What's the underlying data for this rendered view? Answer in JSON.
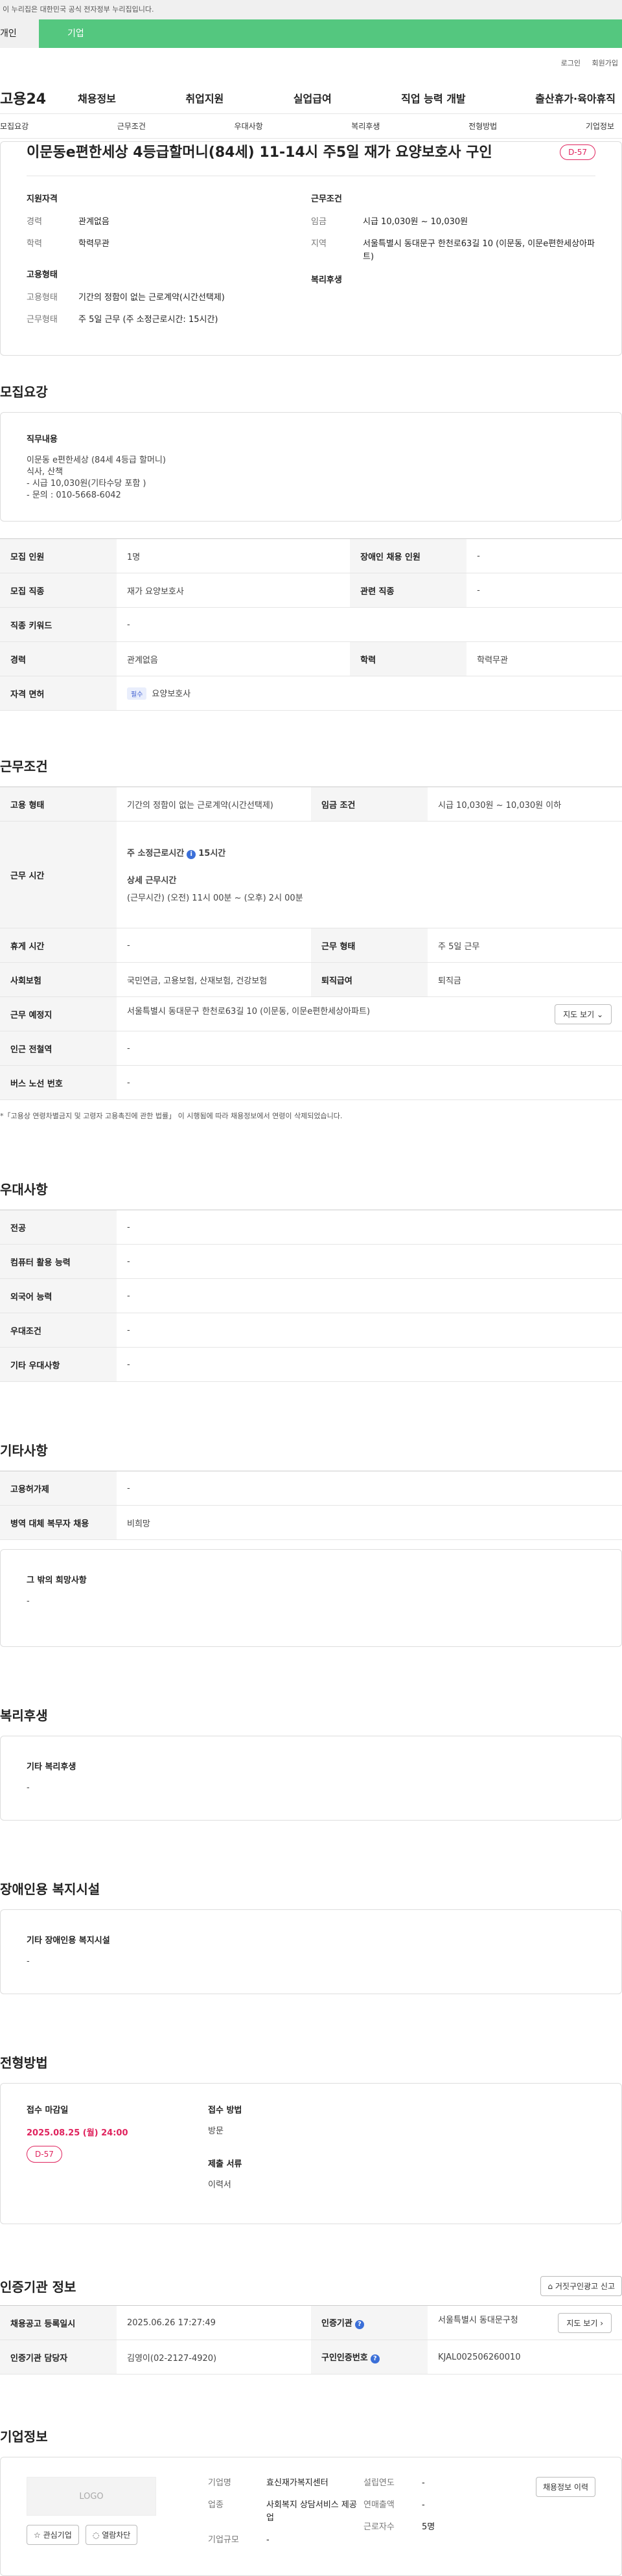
{
  "gov_bar": "이 누리집은 대한민국 공식 전자정부 누리집입니다.",
  "tabs": {
    "individual": "개인",
    "company": "기업"
  },
  "util": {
    "login": "로그인",
    "signup": "회원가입"
  },
  "gnb": {
    "logo": "고용24",
    "menu": [
      "채용정보",
      "취업지원",
      "실업급여",
      "직업 능력 개발",
      "출산휴가·육아휴직"
    ]
  },
  "subnav": [
    "모집요강",
    "근무조건",
    "우대사항",
    "복리후생",
    "전형방법",
    "기업정보"
  ],
  "summary": {
    "title": "이문동e편한세상 4등급할머니(84세) 11-14시 주5일 재가 요양보호사 구인",
    "dday": "D-57",
    "qual_h": "지원자격",
    "career_k": "경력",
    "career_v": "관계없음",
    "edu_k": "학력",
    "edu_v": "학력무관",
    "emp_h": "고용형태",
    "emp_k": "고용형태",
    "emp_v": "기간의 정함이 없는 근로계약(시간선택제)",
    "work_k": "근무형태",
    "work_v": "주 5일 근무 (주 소정근로시간: 15시간)",
    "cond_h": "근무조건",
    "wage_k": "임금",
    "wage_v": "시급 10,030원 ~ 10,030원",
    "region_k": "지역",
    "region_v": "서울특별시 동대문구 한천로63길 10 (이문동, 이문e편한세상아파트)",
    "welfare_h": "복리후생"
  },
  "recruit": {
    "title": "모집요강",
    "duty_h": "직무내용",
    "duty_lines": [
      "이문동 e편한세상 (84세 4등급 할머니)",
      "식사, 산책",
      "- 시급 10,030원(기타수당 포함 )",
      "- 문의 : 010-5668-6042"
    ],
    "rows": {
      "count_k": "모집 인원",
      "count_v": "1명",
      "disabled_k": "장애인 채용 인원",
      "disabled_v": "-",
      "job_k": "모집 직종",
      "job_v": "재가 요양보호사",
      "rel_k": "관련 직종",
      "rel_v": "-",
      "kw_k": "직종 키워드",
      "kw_v": "-",
      "career_k": "경력",
      "career_v": "관계없음",
      "edu_k": "학력",
      "edu_v": "학력무관",
      "license_k": "자격 면허",
      "license_badge": "필수",
      "license_v": "요양보호사"
    }
  },
  "work": {
    "title": "근무조건",
    "emp_k": "고용 형태",
    "emp_v": "기간의 정함이 없는 근로계약(시간선택제)",
    "wage_k": "임금 조건",
    "wage_v": "시급 10,030원 ~ 10,030원 이하",
    "time_k": "근무 시간",
    "time_main": "주 소정근로시간",
    "time_hours": "15시간",
    "time_detail_h": "상세 근무시간",
    "time_detail": "(근무시간) (오전) 11시 00분 ~ (오후) 2시 00분",
    "rest_k": "휴게 시간",
    "rest_v": "-",
    "form_k": "근무 형태",
    "form_v": "주 5일 근무",
    "ins_k": "사회보험",
    "ins_v": "국민연금, 고용보험, 산재보험, 건강보험",
    "sev_k": "퇴직급여",
    "sev_v": "퇴직금",
    "place_k": "근무 예정지",
    "place_v": "서울특별시 동대문구 한천로63길 10 (이문동, 이문e편한세상아파트)",
    "map_btn": "지도 보기",
    "station_k": "인근 전철역",
    "station_v": "-",
    "bus_k": "버스 노선 번호",
    "bus_v": "-",
    "note": "*「고용상 연령차별금지 및 고령자 고용촉진에 관한 법률」 이 시행됨에 따라 채용정보에서 연령이 삭제되었습니다."
  },
  "pref": {
    "title": "우대사항",
    "rows": [
      {
        "k": "전공",
        "v": "-"
      },
      {
        "k": "컴퓨터 활용 능력",
        "v": "-"
      },
      {
        "k": "외국어 능력",
        "v": "-"
      },
      {
        "k": "우대조건",
        "v": "-"
      },
      {
        "k": "기타 우대사항",
        "v": "-"
      }
    ]
  },
  "etc": {
    "title": "기타사항",
    "rows": [
      {
        "k": "고용허가제",
        "v": "-"
      },
      {
        "k": "병역 대체 복무자 채용",
        "v": "비희망"
      }
    ],
    "other_h": "그 밖의 희망사항",
    "other_v": "-"
  },
  "welfare": {
    "title": "복리후생",
    "h": "기타 복리후생",
    "v": "-"
  },
  "facility": {
    "title": "장애인용 복지시설",
    "h": "기타 장애인용 복지시설",
    "v": "-"
  },
  "process": {
    "title": "전형방법",
    "deadline_h": "접수 마감일",
    "deadline_v": "2025.08.25 (월) 24:00",
    "dday": "D-57",
    "method_h": "접수 방법",
    "method_v": "방문",
    "docs_h": "제출 서류",
    "docs_v": "이력서"
  },
  "agency": {
    "title": "인증기관 정보",
    "report_btn": "거짓구인광고 신고",
    "reg_k": "채용공고 등록일시",
    "reg_v": "2025.06.26 17:27:49",
    "org_k": "인증기관",
    "org_v": "서울특별시 동대문구청",
    "map_btn": "지도 보기",
    "mgr_k": "인증기관 담당자",
    "mgr_v": "김영이(02-2127-4920)",
    "no_k": "구인인증번호",
    "no_v": "KJAL002506260010"
  },
  "corp": {
    "title": "기업정보",
    "logo": "LOGO",
    "fav_btn": "관심기업",
    "block_btn": "열람차단",
    "history_btn": "채용정보 이력",
    "name_k": "기업명",
    "name_v": "효신재가복지센터",
    "biz_k": "업종",
    "biz_v": "사회복지 상담서비스 제공업",
    "size_k": "기업규모",
    "size_v": "-",
    "found_k": "설립연도",
    "found_v": "-",
    "sales_k": "연매출액",
    "sales_v": "-",
    "emp_k": "근로자수",
    "emp_v": "5명"
  }
}
